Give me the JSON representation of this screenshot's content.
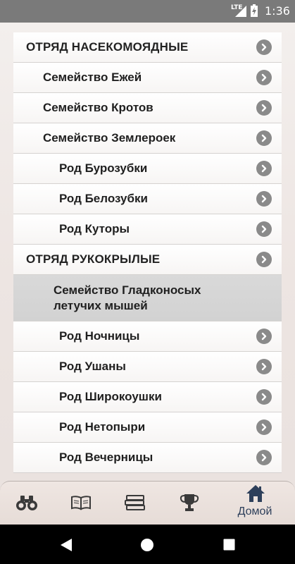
{
  "status_bar": {
    "network": "LTE",
    "time": "1:36"
  },
  "list": {
    "rows": [
      {
        "label": "ОТРЯД НАСЕКОМОЯДНЫЕ",
        "level": 0
      },
      {
        "label": "Семейство Ежей",
        "level": 1
      },
      {
        "label": "Семейство Кротов",
        "level": 1
      },
      {
        "label": "Семейство Землероек",
        "level": 1
      },
      {
        "label": "Род Бурозубки",
        "level": 2
      },
      {
        "label": "Род Белозубки",
        "level": 2
      },
      {
        "label": "Род Куторы",
        "level": 2
      },
      {
        "label": "ОТРЯД РУКОКРЫЛЫЕ",
        "level": 0
      },
      {
        "label": "Семейство Гладконосых летучих мышей",
        "level": 1,
        "selected": true
      },
      {
        "label": "Род Ночницы",
        "level": 2
      },
      {
        "label": "Род Ушаны",
        "level": 2
      },
      {
        "label": "Род Широкоушки",
        "level": 2
      },
      {
        "label": "Род Нетопыри",
        "level": 2
      },
      {
        "label": "Род Вечерницы",
        "level": 2
      }
    ]
  },
  "bottom_nav": {
    "items": [
      {
        "icon": "binoculars-icon"
      },
      {
        "icon": "book-icon"
      },
      {
        "icon": "books-stack-icon"
      },
      {
        "icon": "trophy-icon"
      },
      {
        "icon": "home-icon",
        "label": "Домой",
        "active": true
      }
    ]
  },
  "colors": {
    "accent": "#2d3f5a",
    "chevron": "#8a8a8a",
    "selected_row": "#d5d5d5"
  }
}
